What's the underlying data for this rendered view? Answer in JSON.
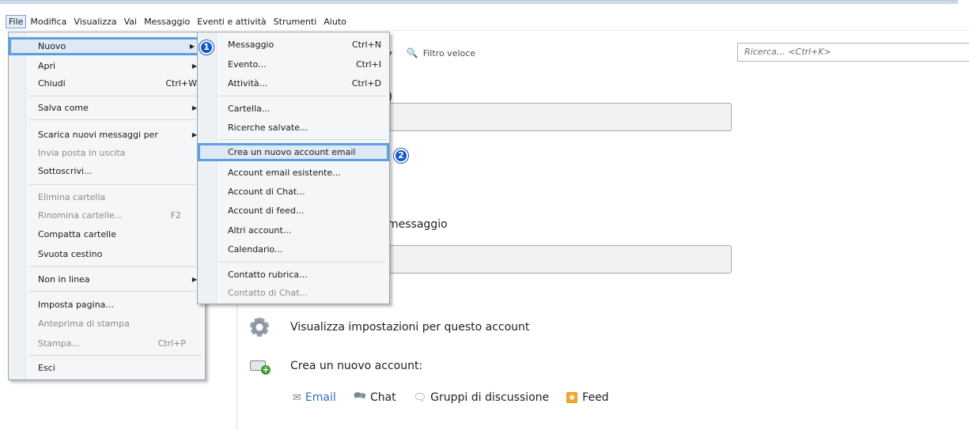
{
  "menubar": {
    "items": [
      "File",
      "Modifica",
      "Visualizza",
      "Vai",
      "Messaggio",
      "Eventi e attività",
      "Strumenti",
      "Aiuto"
    ]
  },
  "toolbar": {
    "partial_label": "a ▾",
    "filter_label": "Filtro veloce",
    "search_placeholder": "Ricerca… <Ctrl+K>"
  },
  "file_menu": {
    "items": [
      {
        "label": "Nuovo",
        "shortcut": "",
        "submenu": true
      },
      {
        "label": "Apri",
        "shortcut": "",
        "submenu": true
      },
      {
        "label": "Chiudi",
        "shortcut": "Ctrl+W",
        "submenu": false
      },
      {
        "label": "Salva come",
        "shortcut": "",
        "submenu": true
      },
      {
        "label": "Scarica nuovi messaggi per",
        "shortcut": "",
        "submenu": true
      },
      {
        "label": "Invia posta in uscita",
        "shortcut": "",
        "submenu": false
      },
      {
        "label": "Sottoscrivi...",
        "shortcut": "",
        "submenu": false
      },
      {
        "label": "Elimina cartella",
        "shortcut": "",
        "submenu": false
      },
      {
        "label": "Rinomina cartelle...",
        "shortcut": "F2",
        "submenu": false
      },
      {
        "label": "Compatta cartelle",
        "shortcut": "",
        "submenu": false
      },
      {
        "label": "Svuota cestino",
        "shortcut": "",
        "submenu": false
      },
      {
        "label": "Non in linea",
        "shortcut": "",
        "submenu": true
      },
      {
        "label": "Imposta pagina...",
        "shortcut": "",
        "submenu": false
      },
      {
        "label": "Anteprima di stampa",
        "shortcut": "",
        "submenu": false
      },
      {
        "label": "Stampa...",
        "shortcut": "Ctrl+P",
        "submenu": false
      },
      {
        "label": "Esci",
        "shortcut": "",
        "submenu": false
      }
    ]
  },
  "new_submenu": {
    "items": [
      {
        "label": "Messaggio",
        "shortcut": "Ctrl+N"
      },
      {
        "label": "Evento...",
        "shortcut": "Ctrl+I"
      },
      {
        "label": "Attività...",
        "shortcut": "Ctrl+D"
      },
      {
        "label": "Cartella...",
        "shortcut": ""
      },
      {
        "label": "Ricerche salvate...",
        "shortcut": ""
      },
      {
        "label": "Crea un nuovo account email",
        "shortcut": ""
      },
      {
        "label": "Account email esistente...",
        "shortcut": ""
      },
      {
        "label": "Account di Chat...",
        "shortcut": ""
      },
      {
        "label": "Account di feed...",
        "shortcut": ""
      },
      {
        "label": "Altri account...",
        "shortcut": ""
      },
      {
        "label": "Calendario...",
        "shortcut": ""
      },
      {
        "label": "Contatto rubrica...",
        "shortcut": ""
      },
      {
        "label": "Contatto di Chat...",
        "shortcut": ""
      }
    ]
  },
  "badges": {
    "one": "1",
    "two": "2"
  },
  "main": {
    "partial_text": "messaggio",
    "partial_top": ")",
    "settings_label": "Visualizza impostazioni per questo account",
    "create_label": "Crea un nuovo account:",
    "links": {
      "email": "Email",
      "chat": "Chat",
      "newsgroups": "Gruppi di discussione",
      "feed": "Feed"
    }
  }
}
